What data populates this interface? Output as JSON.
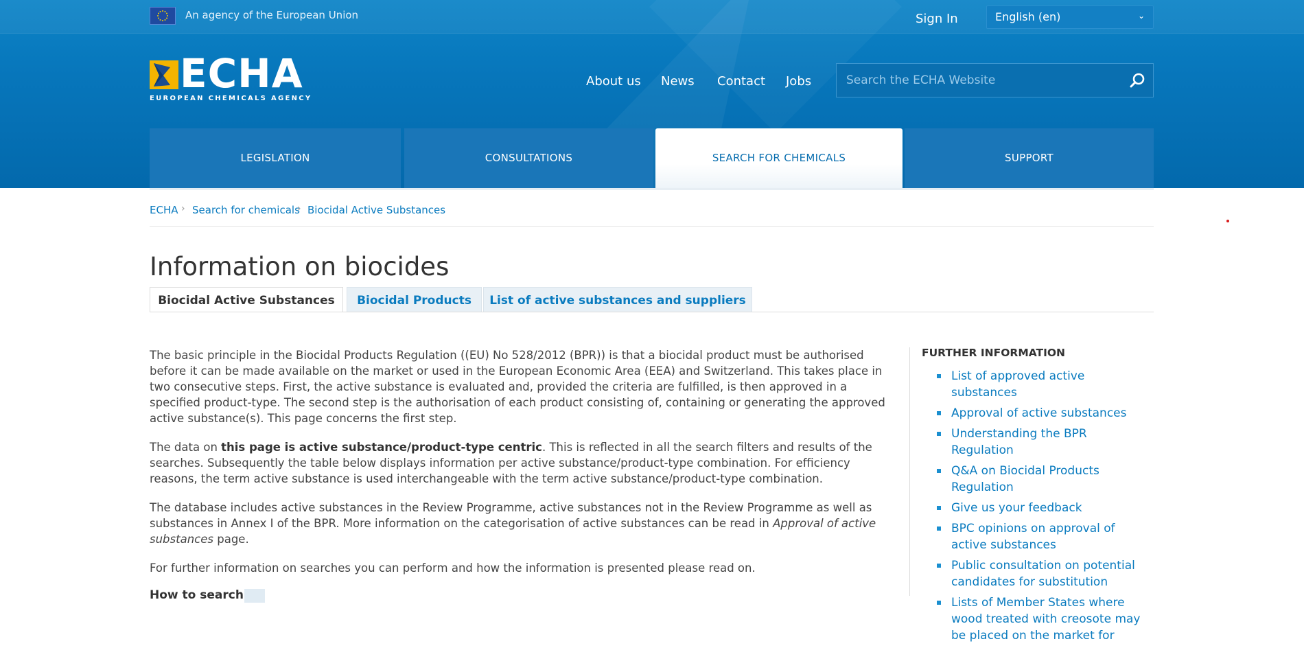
{
  "topbar": {
    "agency_text": "An agency of the European Union",
    "sign_in": "Sign In",
    "language": "English (en)"
  },
  "logo": {
    "word": "ECHA",
    "subtitle": "EUROPEAN CHEMICALS AGENCY"
  },
  "topnav": [
    "About us",
    "News",
    "Contact",
    "Jobs"
  ],
  "search": {
    "placeholder": "Search the ECHA Website"
  },
  "mainnav": [
    {
      "label": "LEGISLATION",
      "active": false
    },
    {
      "label": "CONSULTATIONS",
      "active": false
    },
    {
      "label": "SEARCH FOR CHEMICALS",
      "active": true
    },
    {
      "label": "SUPPORT",
      "active": false
    }
  ],
  "breadcrumb": [
    "ECHA",
    "Search for chemicals",
    "Biocidal Active Substances"
  ],
  "page_title": "Information on biocides",
  "tabs": [
    {
      "label": "Biocidal Active Substances",
      "active": true
    },
    {
      "label": "Biocidal Products",
      "active": false
    },
    {
      "label": "List of active substances and suppliers",
      "active": false
    }
  ],
  "content": {
    "p1": "The basic principle in the Biocidal Products Regulation ((EU) No 528/2012 (BPR)) is that a biocidal product must be authorised before it can be made available on the market or used in the European Economic Area (EEA) and Switzerland. This takes place in two consecutive steps. First, the active substance is evaluated and, provided the criteria are fulfilled, is then approved in a specified product-type. The second step is the authorisation of each product consisting of, containing or generating the approved active substance(s). This page concerns the first step.",
    "p2_pre": "The data on ",
    "p2_bold": "this page is active substance/product-type centric",
    "p2_post": ". This is reflected in all the search filters and results of the searches. Subsequently the table below displays information per active substance/product-type combination. For efficiency reasons, the term active substance is used interchangeable with the term active substance/product-type combination.",
    "p3_pre": "The database includes active substances in the Review Programme, active substances not in the Review Programme as well as substances in Annex I of the BPR. More information on the categorisation of active substances can be read in ",
    "p3_italic": "Approval of active substances",
    "p3_post": " page.",
    "p4": "For further information on searches you can perform and how the information is presented please read on.",
    "how_to": "How to search"
  },
  "sidebar": {
    "title": "FURTHER INFORMATION",
    "items": [
      "List of approved active substances",
      "Approval of active substances",
      "Understanding the BPR Regulation",
      "Q&A on Biocidal Products Regulation",
      "Give us your feedback",
      "BPC opinions on approval of active substances",
      "Public consultation on potential candidates for substitution",
      "Lists of Member States where wood treated with creosote may be placed on the market for"
    ]
  },
  "colors": {
    "header_blue": "#0776bb",
    "link_blue": "#0a7bbf",
    "logo_yellow": "#f4b400"
  }
}
